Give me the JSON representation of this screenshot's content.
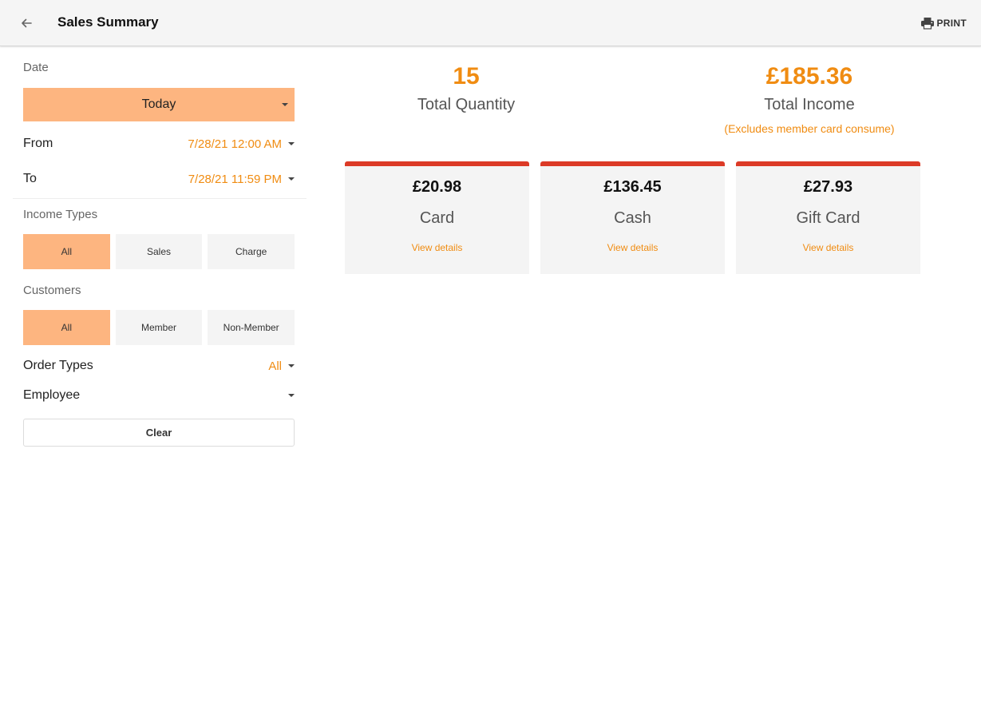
{
  "header": {
    "title": "Sales Summary",
    "back_icon": "arrow-left-icon",
    "print_icon": "printer-icon",
    "print_label": "PRINT"
  },
  "filters": {
    "date": {
      "label": "Date",
      "selected": "Today",
      "from_label": "From",
      "from_value": "7/28/21 12:00 AM",
      "to_label": "To",
      "to_value": "7/28/21 11:59 PM"
    },
    "income_types": {
      "label": "Income Types",
      "options": [
        "All",
        "Sales",
        "Charge"
      ],
      "selected": "All"
    },
    "customers": {
      "label": "Customers",
      "options": [
        "All",
        "Member",
        "Non-Member"
      ],
      "selected": "All"
    },
    "order_types": {
      "label": "Order Types",
      "value": "All"
    },
    "employee": {
      "label": "Employee",
      "value": ""
    },
    "clear_label": "Clear"
  },
  "summary": {
    "total_quantity": {
      "value": "15",
      "label": "Total Quantity"
    },
    "total_income": {
      "value": "£185.36",
      "label": "Total Income",
      "note": "(Excludes member card consume)"
    }
  },
  "payment_cards": [
    {
      "amount": "£20.98",
      "label": "Card",
      "link": "View details"
    },
    {
      "amount": "£136.45",
      "label": "Cash",
      "link": "View details"
    },
    {
      "amount": "£27.93",
      "label": "Gift Card",
      "link": "View details"
    }
  ],
  "colors": {
    "accent": "#f08c12",
    "active_fill": "#fdb580",
    "card_top_border": "#dc3a26",
    "card_bg": "#f4f4f4",
    "appbar_bg": "#f5f5f5"
  }
}
